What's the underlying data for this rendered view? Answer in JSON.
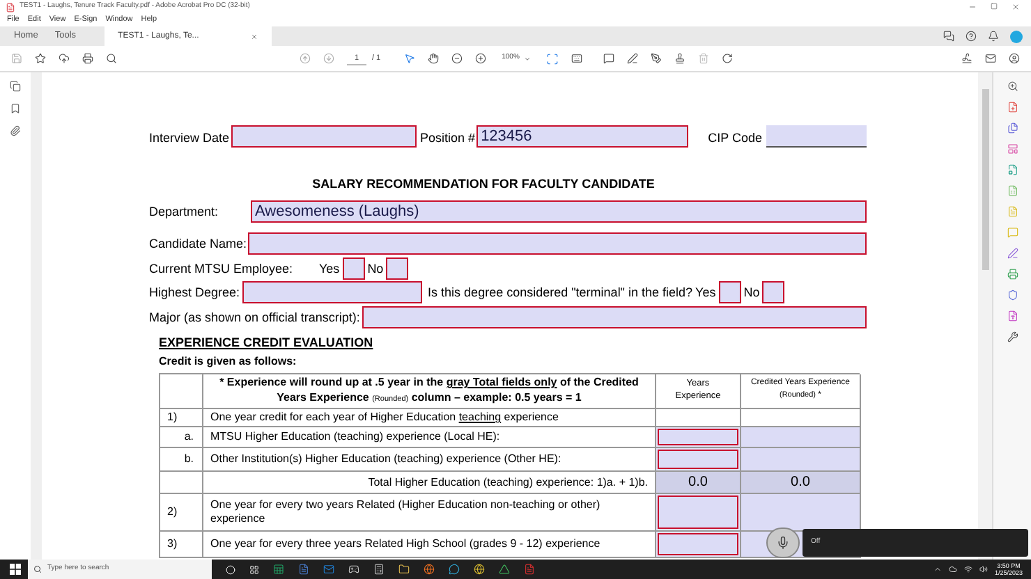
{
  "window": {
    "title": "TEST1 - Laughs, Tenure Track Faculty.pdf - Adobe Acrobat Pro DC (32-bit)"
  },
  "menu": [
    "File",
    "Edit",
    "View",
    "E-Sign",
    "Window",
    "Help"
  ],
  "tabs": [
    {
      "label": "Home",
      "selected": false
    },
    {
      "label": "Tools",
      "selected": false
    },
    {
      "label": "TEST1 - Laughs, Te...",
      "selected": true
    }
  ],
  "toolbar": {
    "page": "1",
    "page_total": "/ 1",
    "zoom": "100%"
  },
  "form": {
    "top_fields": [
      {
        "label": "Interview Date",
        "kind": "boxed"
      },
      {
        "label": "Position #",
        "kind": "boxed",
        "value": "123456"
      },
      {
        "label": "CIP Code",
        "kind": "underline"
      }
    ],
    "title": "SALARY RECOMMENDATION FOR FACULTY CANDIDATE",
    "department": {
      "label": "Department:",
      "value": "Awesomeness (Laughs)"
    },
    "candidate": {
      "label": "Candidate Name:"
    },
    "employee": {
      "label": "Current MTSU Employee:",
      "options": [
        {
          "label": "Yes",
          "checked": false
        },
        {
          "label": "No",
          "checked": false
        }
      ]
    },
    "degree": {
      "label": "Highest Degree:",
      "question": "Is this degree considered \"terminal\" in the field?",
      "options": [
        {
          "label": "Yes",
          "checked": false
        },
        {
          "label": "No",
          "checked": false
        }
      ]
    },
    "major": {
      "label": "Major (as shown on official transcript):"
    },
    "section_title": "EXPERIENCE CREDIT EVALUATION",
    "section_subtitle": "Credit is given as follows:",
    "table": {
      "note": [
        "* Experience will round up at .5 year in the ",
        "gray Total fields only",
        " of the Credited Years Experience ",
        "(Rounded)",
        " column – example: 0.5 years = 1"
      ],
      "years_header": "Years Experience",
      "credited_header": [
        "Credited Years Experience ",
        "(Rounded)",
        " *"
      ],
      "rows": [
        {
          "kind": "section",
          "number": "1)",
          "parts": [
            "One year credit for each year of Higher Education ",
            "teaching",
            " experience"
          ]
        },
        {
          "kind": "input",
          "number": "a.",
          "text": "MTSU Higher Education (teaching) experience (Local HE):"
        },
        {
          "kind": "input",
          "number": "b.",
          "text": "Other Institution(s) Higher Education (teaching) experience (Other HE):"
        },
        {
          "kind": "total",
          "text": "Total Higher Education (teaching) experience:  1)a. + 1)b.",
          "years": "0.0",
          "credited": "0.0"
        },
        {
          "kind": "input",
          "number": "2)",
          "text": "One year for every two years Related (Higher Education non-teaching or other) experience"
        },
        {
          "kind": "input",
          "number": "3)",
          "text": "One year for every three years Related High School (grades 9 - 12) experience"
        }
      ]
    }
  },
  "popup": {
    "label": "Off"
  },
  "taskbar": {
    "search": {
      "placeholder": "Type here to search"
    },
    "time": "3:50 PM",
    "date": "1/25/2023"
  }
}
